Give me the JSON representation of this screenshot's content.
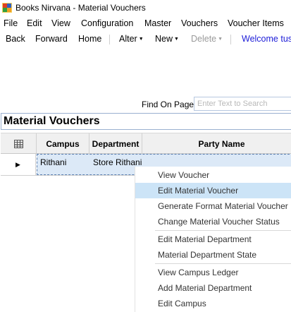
{
  "window": {
    "title": "Books Nirvana - Material Vouchers"
  },
  "menu": {
    "file": "File",
    "edit": "Edit",
    "view": "View",
    "configuration": "Configuration",
    "master": "Master",
    "vouchers": "Vouchers",
    "voucher_items": "Voucher Items"
  },
  "toolbar": {
    "back": "Back",
    "forward": "Forward",
    "home": "Home",
    "alter": "Alter",
    "new": "New",
    "delete": "Delete",
    "welcome": "Welcome tusl"
  },
  "find": {
    "label": "Find On Page",
    "placeholder": "Enter Text to Search"
  },
  "section": {
    "title": "Material Vouchers"
  },
  "grid": {
    "columns": [
      "Campus",
      "Department",
      "Party Name"
    ],
    "rows": [
      {
        "campus": "Rithani",
        "department": "Store Rithani",
        "party_name": ""
      }
    ]
  },
  "context_menu": {
    "items": [
      "View Voucher",
      "Edit Material Voucher",
      "Generate Format Material Voucher",
      "Change Material Voucher Status",
      "Edit Material Department",
      "Material Department State",
      "View Campus Ledger",
      "Add Material Department",
      "Edit Campus"
    ],
    "hovered_index": 1
  },
  "colors": {
    "selection": "#dce9f7",
    "menu_hover": "#cce4f7",
    "link": "#1c1cd8"
  }
}
